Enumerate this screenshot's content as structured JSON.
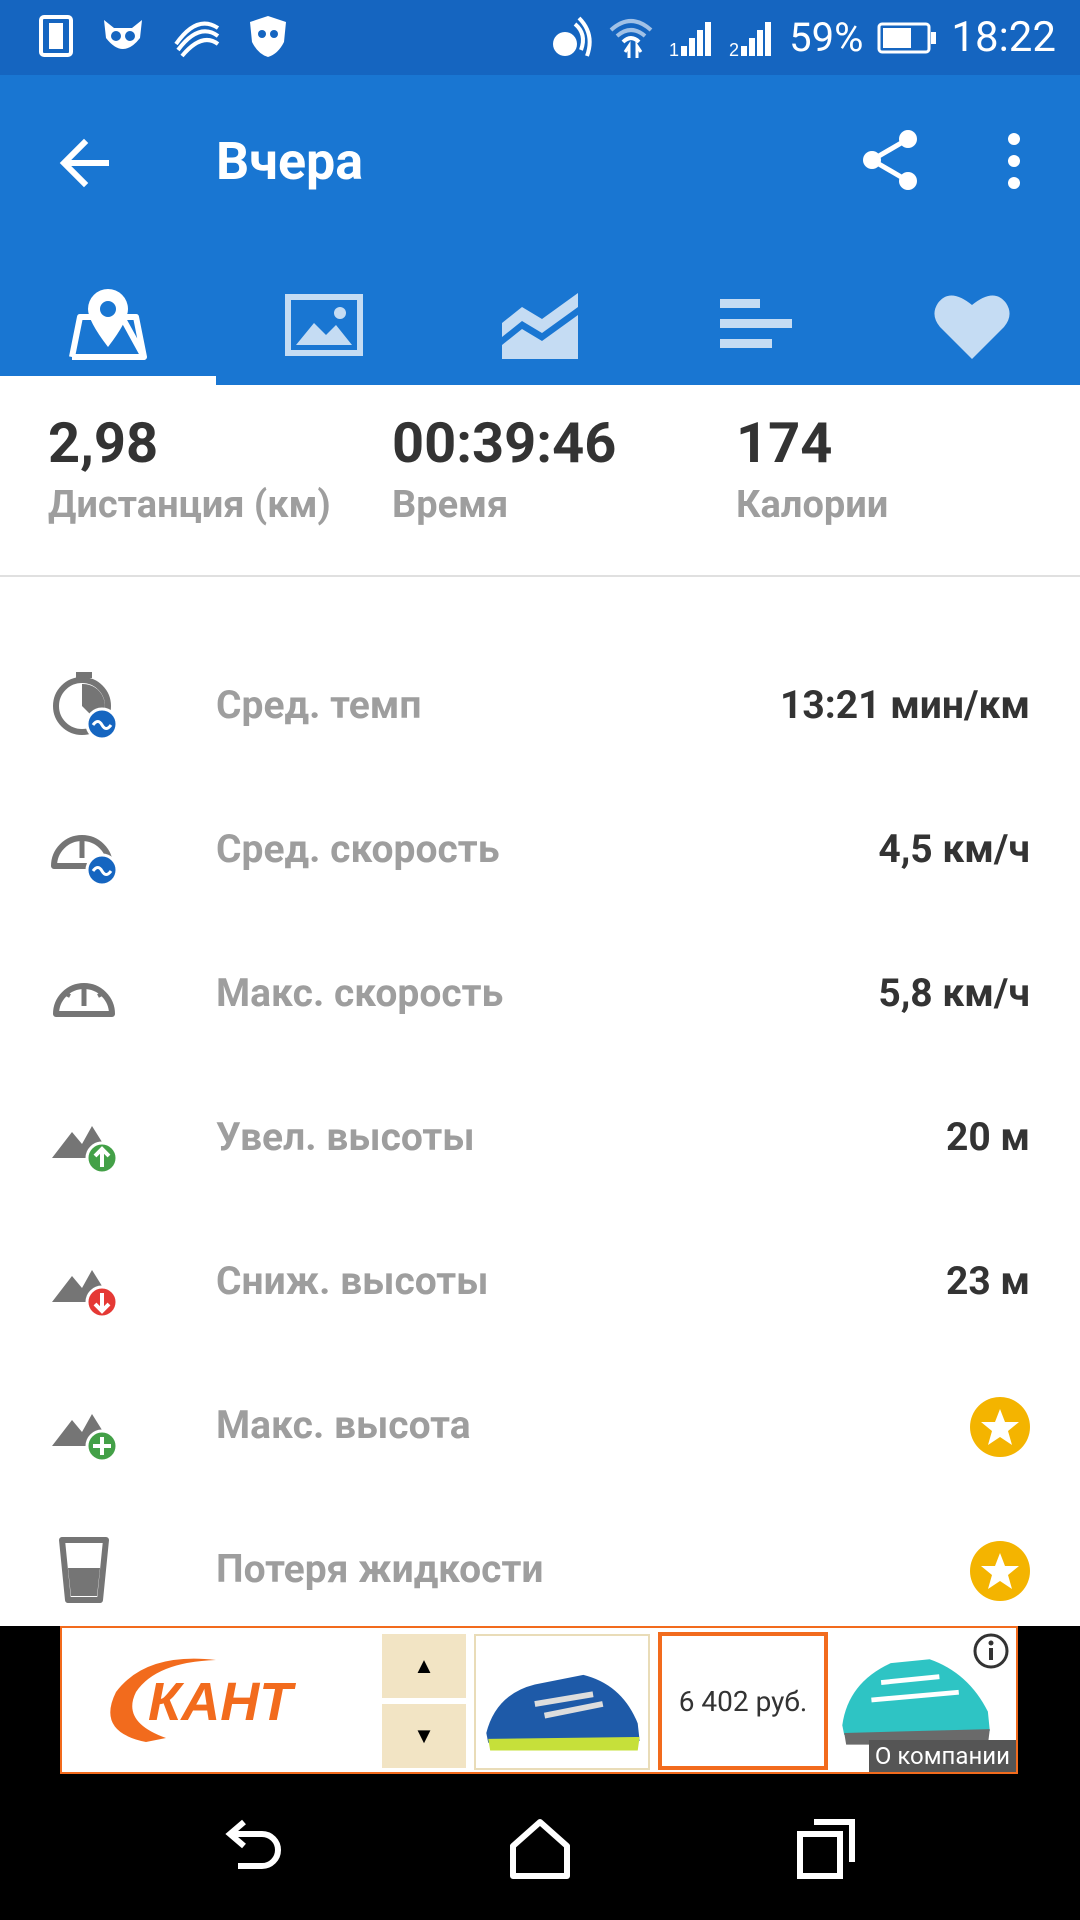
{
  "status_bar": {
    "battery_percent": "59%",
    "time": "18:22",
    "left_icons": [
      "phone-icon",
      "owl-icon",
      "swiftkey-icon",
      "shield-icon"
    ],
    "right_icons": [
      "nfc-icon",
      "wifi-icon",
      "signal-sim1-icon",
      "signal-sim2-icon",
      "battery-icon"
    ]
  },
  "app_bar": {
    "title": "Вчера",
    "back_icon": "arrow-back-icon",
    "share_icon": "share-icon",
    "more_icon": "more-vert-icon"
  },
  "tabs": [
    {
      "icon": "map-pin-icon",
      "active": true
    },
    {
      "icon": "photo-icon",
      "active": false
    },
    {
      "icon": "chart-icon",
      "active": false
    },
    {
      "icon": "list-bars-icon",
      "active": false
    },
    {
      "icon": "heart-icon",
      "active": false
    }
  ],
  "summary": [
    {
      "value": "2,98",
      "label": "Дистанция (км)"
    },
    {
      "value": "00:39:46",
      "label": "Время"
    },
    {
      "value": "174",
      "label": "Калории"
    }
  ],
  "stats": [
    {
      "icon": "stopwatch-avg-icon",
      "label": "Сред. темп",
      "value": "13:21 мин/км"
    },
    {
      "icon": "speedometer-avg-icon",
      "label": "Сред. скорость",
      "value": "4,5 км/ч"
    },
    {
      "icon": "speedometer-icon",
      "label": "Макс. скорость",
      "value": "5,8 км/ч"
    },
    {
      "icon": "elevation-gain-icon",
      "label": "Увел. высоты",
      "value": "20 м"
    },
    {
      "icon": "elevation-loss-icon",
      "label": "Сниж. высоты",
      "value": "23 м"
    },
    {
      "icon": "elevation-max-icon",
      "label": "Макс. высота",
      "value": "",
      "premium": true
    },
    {
      "icon": "glass-icon",
      "label": "Потеря жидкости",
      "value": "",
      "premium": true
    }
  ],
  "ad": {
    "brand": "КАНТ",
    "price": "6 402 руб.",
    "company_link": "О компании"
  },
  "colors": {
    "status_bar": "#1565c0",
    "app_bar": "#1976d2",
    "premium_star": "#f4b400",
    "ad_accent": "#f26b1d"
  }
}
